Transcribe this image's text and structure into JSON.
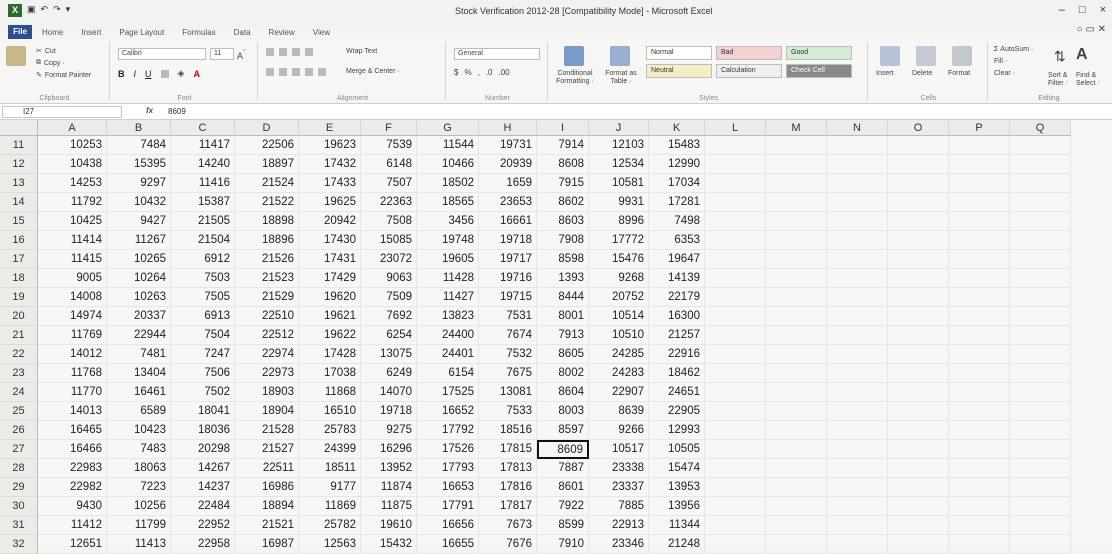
{
  "window": {
    "title": "Stock Verification 2012-28 [Compatibility Mode] - Microsoft Excel",
    "controls": [
      "–",
      "□",
      "×"
    ]
  },
  "ribbon_tabs": [
    "File",
    "Home",
    "Insert",
    "Page Layout",
    "Formulas",
    "Data",
    "Review",
    "View"
  ],
  "ribbon": {
    "clipboard": {
      "cut": "Cut",
      "copy": "Copy ·",
      "format_painter": "Format Painter",
      "label": "Clipboard"
    },
    "font": {
      "name": "Calibri",
      "size": "11",
      "label": "Font"
    },
    "alignment": {
      "wrap_text": "Wrap Text",
      "merge_center": "Merge & Center ·",
      "label": "Alignment"
    },
    "number": {
      "format": "General",
      "label": "Number"
    },
    "styles": {
      "conditional": "Conditional Formatting ·",
      "format_table": "Format as Table ·",
      "normal": "Normal",
      "bad": "Bad",
      "good": "Good",
      "neutral": "Neutral",
      "calculation": "Calculation",
      "check_cell": "Check Cell",
      "label": "Styles"
    },
    "cells": {
      "insert": "Insert",
      "delete": "Delete",
      "format": "Format",
      "label": "Cells"
    },
    "editing": {
      "autosum": "AutoSum ·",
      "fill": "Fill ·",
      "clear": "Clear ·",
      "sort_filter": "Sort & Filter ·",
      "find_select": "Find & Select ·",
      "label": "Editing"
    }
  },
  "formula_bar": {
    "name_box": "I27",
    "fx": "fx",
    "content": "8609"
  },
  "columns": [
    "A",
    "B",
    "C",
    "D",
    "E",
    "F",
    "G",
    "H",
    "I",
    "J",
    "K",
    "L",
    "M",
    "N",
    "O",
    "P",
    "Q"
  ],
  "rows": [
    {
      "n": "11",
      "v": [
        "10253",
        "7484",
        "11417",
        "22506",
        "19623",
        "7539",
        "11544",
        "19731",
        "7914",
        "12103",
        "15483"
      ]
    },
    {
      "n": "12",
      "v": [
        "10438",
        "15395",
        "14240",
        "18897",
        "17432",
        "6148",
        "10466",
        "20939",
        "8608",
        "12534",
        "12990"
      ]
    },
    {
      "n": "13",
      "v": [
        "14253",
        "9297",
        "11416",
        "21524",
        "17433",
        "7507",
        "18502",
        "1659",
        "7915",
        "10581",
        "17034"
      ]
    },
    {
      "n": "14",
      "v": [
        "11792",
        "10432",
        "15387",
        "21522",
        "19625",
        "22363",
        "18565",
        "23653",
        "8602",
        "9931",
        "17281"
      ]
    },
    {
      "n": "15",
      "v": [
        "10425",
        "9427",
        "21505",
        "18898",
        "20942",
        "7508",
        "3456",
        "16661",
        "8603",
        "8996",
        "7498"
      ]
    },
    {
      "n": "16",
      "v": [
        "11414",
        "11267",
        "21504",
        "18896",
        "17430",
        "15085",
        "19748",
        "19718",
        "7908",
        "17772",
        "6353"
      ]
    },
    {
      "n": "17",
      "v": [
        "11415",
        "10265",
        "6912",
        "21526",
        "17431",
        "23072",
        "19605",
        "19717",
        "8598",
        "15476",
        "19647"
      ]
    },
    {
      "n": "18",
      "v": [
        "9005",
        "10264",
        "7503",
        "21523",
        "17429",
        "9063",
        "11428",
        "19716",
        "1393",
        "9268",
        "14139"
      ]
    },
    {
      "n": "19",
      "v": [
        "14008",
        "10263",
        "7505",
        "21529",
        "19620",
        "7509",
        "11427",
        "19715",
        "8444",
        "20752",
        "22179"
      ]
    },
    {
      "n": "20",
      "v": [
        "14974",
        "20337",
        "6913",
        "22510",
        "19621",
        "7692",
        "13823",
        "7531",
        "8001",
        "10514",
        "16300"
      ]
    },
    {
      "n": "21",
      "v": [
        "11769",
        "22944",
        "7504",
        "22512",
        "19622",
        "6254",
        "24400",
        "7674",
        "7913",
        "10510",
        "21257"
      ]
    },
    {
      "n": "22",
      "v": [
        "14012",
        "7481",
        "7247",
        "22974",
        "17428",
        "13075",
        "24401",
        "7532",
        "8605",
        "24285",
        "22916"
      ]
    },
    {
      "n": "23",
      "v": [
        "11768",
        "13404",
        "7506",
        "22973",
        "17038",
        "6249",
        "6154",
        "7675",
        "8002",
        "24283",
        "18462"
      ]
    },
    {
      "n": "24",
      "v": [
        "11770",
        "16461",
        "7502",
        "18903",
        "11868",
        "14070",
        "17525",
        "13081",
        "8604",
        "22907",
        "24651"
      ]
    },
    {
      "n": "25",
      "v": [
        "14013",
        "6589",
        "18041",
        "18904",
        "16510",
        "19718",
        "16652",
        "7533",
        "8003",
        "8639",
        "22905"
      ]
    },
    {
      "n": "26",
      "v": [
        "16465",
        "10423",
        "18036",
        "21528",
        "25783",
        "9275",
        "17792",
        "18516",
        "8597",
        "9266",
        "12993"
      ]
    },
    {
      "n": "27",
      "v": [
        "16466",
        "7483",
        "20298",
        "21527",
        "24399",
        "16296",
        "17526",
        "17815",
        "8609",
        "10517",
        "10505"
      ]
    },
    {
      "n": "28",
      "v": [
        "22983",
        "18063",
        "14267",
        "22511",
        "18511",
        "13952",
        "17793",
        "17813",
        "7887",
        "23338",
        "15474"
      ]
    },
    {
      "n": "29",
      "v": [
        "22982",
        "7223",
        "14237",
        "16986",
        "9177",
        "11874",
        "16653",
        "17816",
        "8601",
        "23337",
        "13953"
      ]
    },
    {
      "n": "30",
      "v": [
        "9430",
        "10256",
        "22484",
        "18894",
        "11869",
        "11875",
        "17791",
        "17817",
        "7922",
        "7885",
        "13956"
      ]
    },
    {
      "n": "31",
      "v": [
        "11412",
        "11799",
        "22952",
        "21521",
        "25782",
        "19610",
        "16656",
        "7673",
        "8599",
        "22913",
        "11344"
      ]
    },
    {
      "n": "32",
      "v": [
        "12651",
        "11413",
        "22958",
        "16987",
        "12563",
        "15432",
        "16655",
        "7676",
        "7910",
        "23346",
        "21248"
      ]
    }
  ]
}
